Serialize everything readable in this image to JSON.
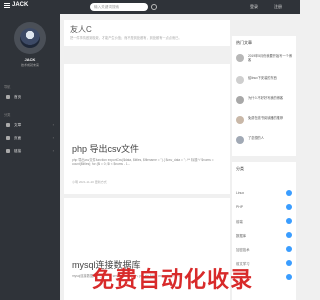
{
  "topbar": {
    "logo": "JACK",
    "search_placeholder": "输入关键词搜索",
    "right1": "登录",
    "right2": "注册"
  },
  "sidebar": {
    "name": "JACK",
    "subtitle": "技术成就未来",
    "section1": "导航",
    "item1": "首页",
    "section2": "分类",
    "item2": "文章",
    "item3": "页面",
    "item4": "链接"
  },
  "main": {
    "friend_title": "友人C",
    "friend_desc": "把一件事情做到极致，才能产生价值；而不是到处都有，到处都有一点点而已。",
    "post1_title": "php 导出csv文件",
    "post1_excerpt": "php 导出csv文件function exportCsv($data, $titles, $filename = '') { $csv_data = ''; /** 标题 */ $nums = count($titles); for ($i = 0; $i < $nums - 1...",
    "post1_meta": "小明  2021-11-20  更新方式",
    "post2_title": "mysql连接数据库",
    "post2_excerpt": "mysql连接数据库 mysql... $user, private $pass, private $dbname, private $dbs..."
  },
  "right": {
    "hot_title": "热门文章",
    "hot_items": [
      "2019年5月份我要开始写一个博客",
      "给linux下安装的东西",
      "为什么不好好写我的博客",
      "免费在线书阅读器的推荐",
      "了念想的人"
    ],
    "cat_title": "分类",
    "categories": [
      "Linux",
      "PHP",
      "前端",
      "数据库",
      "加密技术",
      "前文学习",
      "Web"
    ]
  },
  "overlay": {
    "text": "免费自动化收录"
  }
}
